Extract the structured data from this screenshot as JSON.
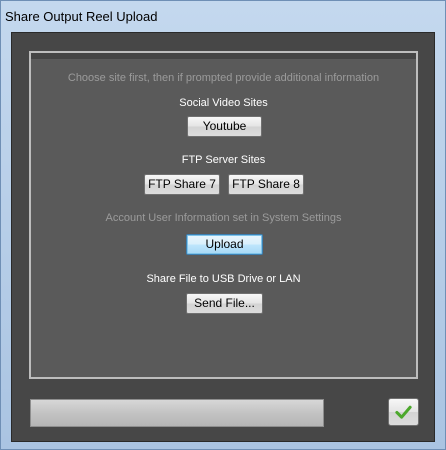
{
  "window": {
    "title": "Share Output Reel Upload"
  },
  "panel": {
    "instructions": "Choose site first, then if prompted provide additional information",
    "social_heading": "Social Video Sites",
    "youtube_label": "Youtube",
    "ftp_heading": "FTP Server Sites",
    "ftp7_label": "FTP Share 7",
    "ftp8_label": "FTP Share 8",
    "account_info": "Account User Information set in System Settings",
    "upload_label": "Upload",
    "usb_heading": "Share File to USB Drive or LAN",
    "send_file_label": "Send File..."
  },
  "footer": {
    "progress_fraction": 0,
    "ok_icon": "checkmark-icon",
    "ok_color": "#4ca82c"
  }
}
